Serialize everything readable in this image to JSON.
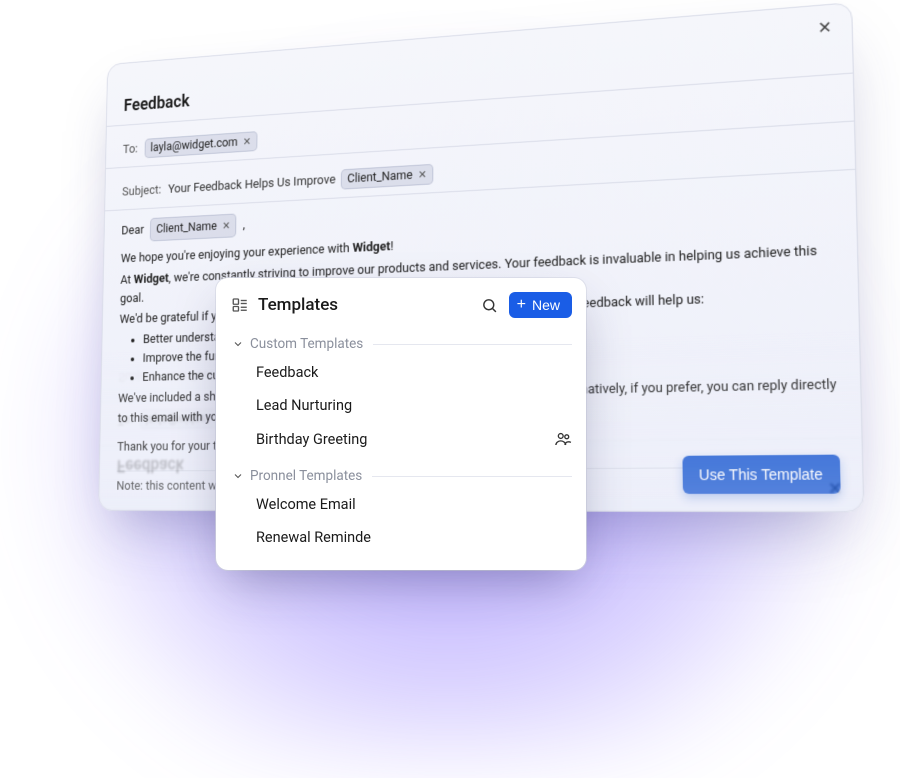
{
  "email": {
    "title": "Feedback",
    "to_label": "To:",
    "to_chip": "layla@widget.com",
    "subject_label": "Subject:",
    "subject_text": "Your Feedback Helps Us Improve",
    "subject_chip": "Client_Name",
    "greeting_prefix": "Dear",
    "greeting_chip": "Client_Name",
    "greeting_suffix": ",",
    "p1a": "We hope you're enjoying your experience with ",
    "p1b_bold": "Widget",
    "p1c": "!",
    "p2a": "At ",
    "p2b_bold": "Widget",
    "p2c": ", we're constantly striving to improve our products and services. Your feedback is invaluable in helping us achieve this goal.",
    "p3": "We'd be grateful if you could take a few minutes to share your experience with us. Your feedback will help us:",
    "bullets": {
      "b1": "Better understand your needs",
      "b2": "Improve the functionality",
      "b3": "Enhance the customer service experience"
    },
    "p4": "We've included a short survey below that will only take a few minutes to complete. Alternatively, if you prefer, you can reply directly to this email with your feedback.",
    "p5": "Thank you for your time and your candid feedback. We appreciate your business!",
    "note": "Note: this content will be added as the actual email content.",
    "cta": "Use This Template"
  },
  "popup": {
    "title": "Templates",
    "new_label": "New",
    "sections": {
      "s1": {
        "title": "Custom Templates"
      },
      "s2": {
        "title": "Pronnel Templates"
      }
    },
    "items": {
      "i1": "Feedback",
      "i2": "Lead Nurturing",
      "i3": "Birthday Greeting",
      "i4": "Welcome Email",
      "i5": "Renewal Reminde"
    }
  }
}
